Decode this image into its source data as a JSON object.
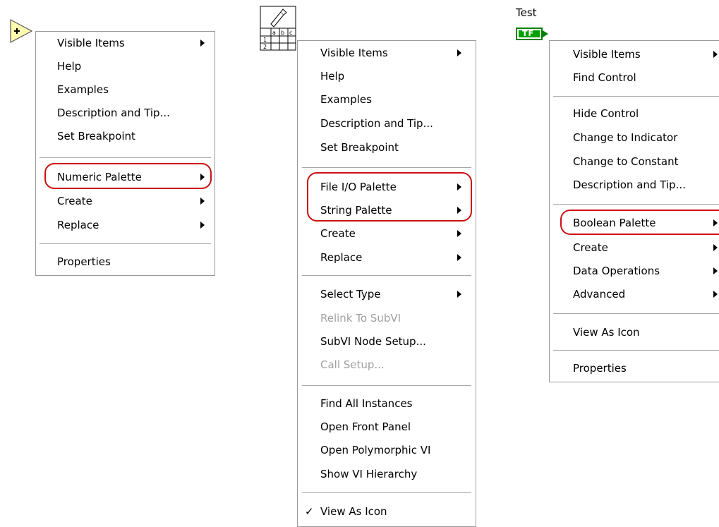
{
  "menu1": {
    "items": [
      {
        "label": "Visible Items",
        "sub": true
      },
      {
        "label": "Help"
      },
      {
        "label": "Examples"
      },
      {
        "label": "Description and Tip..."
      },
      {
        "label": "Set Breakpoint"
      },
      {
        "label": "Numeric Palette",
        "sub": true,
        "highlighted": true
      },
      {
        "label": "Create",
        "sub": true
      },
      {
        "label": "Replace",
        "sub": true
      },
      {
        "label": "Properties"
      }
    ]
  },
  "menu2": {
    "items": [
      {
        "label": "Visible Items",
        "sub": true
      },
      {
        "label": "Help"
      },
      {
        "label": "Examples"
      },
      {
        "label": "Description and Tip..."
      },
      {
        "label": "Set Breakpoint"
      },
      {
        "label": "File I/O Palette",
        "sub": true,
        "highlighted": true
      },
      {
        "label": "String Palette",
        "sub": true,
        "highlighted": true
      },
      {
        "label": "Create",
        "sub": true
      },
      {
        "label": "Replace",
        "sub": true
      },
      {
        "label": "Select Type",
        "sub": true
      },
      {
        "label": "Relink To SubVI",
        "disabled": true
      },
      {
        "label": "SubVI Node Setup..."
      },
      {
        "label": "Call Setup...",
        "disabled": true
      },
      {
        "label": "Find All Instances"
      },
      {
        "label": "Open Front Panel"
      },
      {
        "label": "Open Polymorphic VI"
      },
      {
        "label": "Show VI Hierarchy"
      },
      {
        "label": "View As Icon",
        "checked": true
      }
    ]
  },
  "menu3": {
    "control_label": "Test",
    "terminal_text": "TF",
    "items": [
      {
        "label": "Visible Items",
        "sub": true
      },
      {
        "label": "Find Control"
      },
      {
        "label": "Hide Control"
      },
      {
        "label": "Change to Indicator"
      },
      {
        "label": "Change to Constant"
      },
      {
        "label": "Description and Tip..."
      },
      {
        "label": "Boolean Palette",
        "sub": true,
        "highlighted": true
      },
      {
        "label": "Create",
        "sub": true
      },
      {
        "label": "Data Operations",
        "sub": true
      },
      {
        "label": "Advanced",
        "sub": true
      },
      {
        "label": "View As Icon"
      },
      {
        "label": "Properties"
      }
    ]
  },
  "colors": {
    "highlight_outline": "#cc1010",
    "numeric_node": "#fffbb0",
    "boolean_terminal": "#008000",
    "disabled_text": "#a0a0a0"
  },
  "icons": {
    "numeric_node": "add-function-icon",
    "subvi_node": "polymorphic-subvi-icon",
    "boolean_terminal": "boolean-terminal-icon"
  }
}
